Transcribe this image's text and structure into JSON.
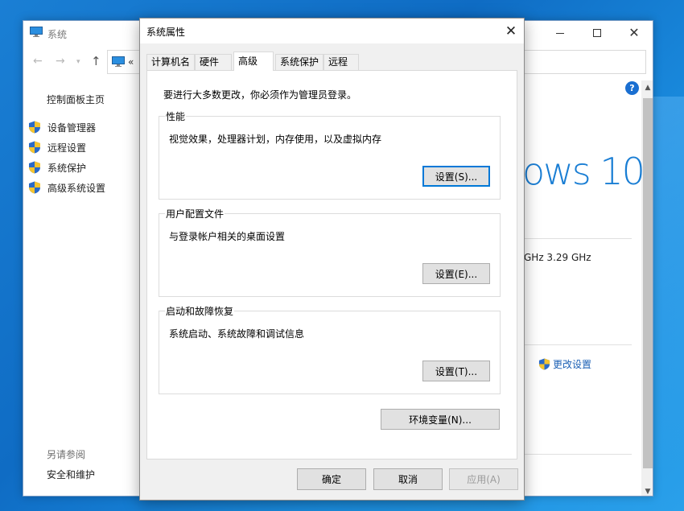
{
  "background_window": {
    "title": "系统",
    "address_text": "«",
    "left_nav": {
      "home": "控制面板主页",
      "items": [
        {
          "label": "设备管理器",
          "icon": "uac-shield-icon"
        },
        {
          "label": "远程设置",
          "icon": "uac-shield-icon"
        },
        {
          "label": "系统保护",
          "icon": "uac-shield-icon"
        },
        {
          "label": "高级系统设置",
          "icon": "uac-shield-icon"
        }
      ],
      "see_also_title": "另请参阅",
      "see_also_item": "安全和维护"
    },
    "windows_logo_text": "ows 10",
    "cpu_speed_text": "GHz   3.29 GHz",
    "change_settings": "更改设置"
  },
  "dialog": {
    "title": "系统属性",
    "tabs": [
      {
        "label": "计算机名",
        "active": false
      },
      {
        "label": "硬件",
        "active": false
      },
      {
        "label": "高级",
        "active": true
      },
      {
        "label": "系统保护",
        "active": false
      },
      {
        "label": "远程",
        "active": false
      }
    ],
    "admin_note": "要进行大多数更改，你必须作为管理员登录。",
    "groups": {
      "performance": {
        "title": "性能",
        "description": "视觉效果，处理器计划，内存使用，以及虚拟内存",
        "button": "设置(S)..."
      },
      "user_profiles": {
        "title": "用户配置文件",
        "description": "与登录帐户相关的桌面设置",
        "button": "设置(E)..."
      },
      "startup_recovery": {
        "title": "启动和故障恢复",
        "description": "系统启动、系统故障和调试信息",
        "button": "设置(T)..."
      }
    },
    "env_button": "环境变量(N)...",
    "footer": {
      "ok": "确定",
      "cancel": "取消",
      "apply": "应用(A)"
    }
  },
  "colors": {
    "accent": "#0078d7",
    "link": "#1a5fb4",
    "win10_blue": "#1a7ed4"
  }
}
